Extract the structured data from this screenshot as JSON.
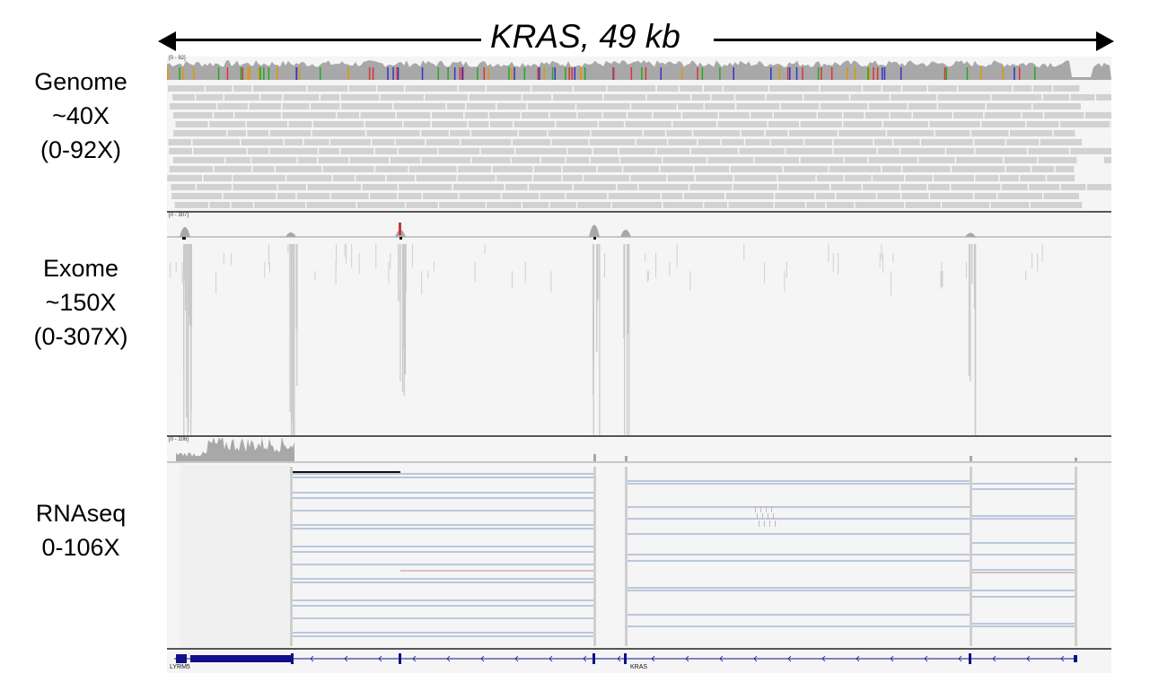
{
  "region": {
    "title": "KRAS, 49 kb"
  },
  "tracks": [
    {
      "label_lines": [
        "Genome",
        "~40X",
        "(0-92X)"
      ],
      "range": "[0 - 92]"
    },
    {
      "label_lines": [
        "Exome",
        "~150X",
        "(0-307X)"
      ],
      "range": "[0 - 307]"
    },
    {
      "label_lines": [
        "RNAseq",
        "0-106X"
      ],
      "range": "[0 - 106]"
    }
  ],
  "genes": [
    {
      "name": "LYRM5"
    },
    {
      "name": "KRAS"
    }
  ],
  "colors": {
    "coverage": "#a8a8a8",
    "read": "#d2d2d2",
    "panel_bg": "#f5f5f5",
    "gene_blue": "#10108a",
    "junction_blue": "#7f9cc4",
    "junction_black": "#111111",
    "divider": "#555555"
  }
}
